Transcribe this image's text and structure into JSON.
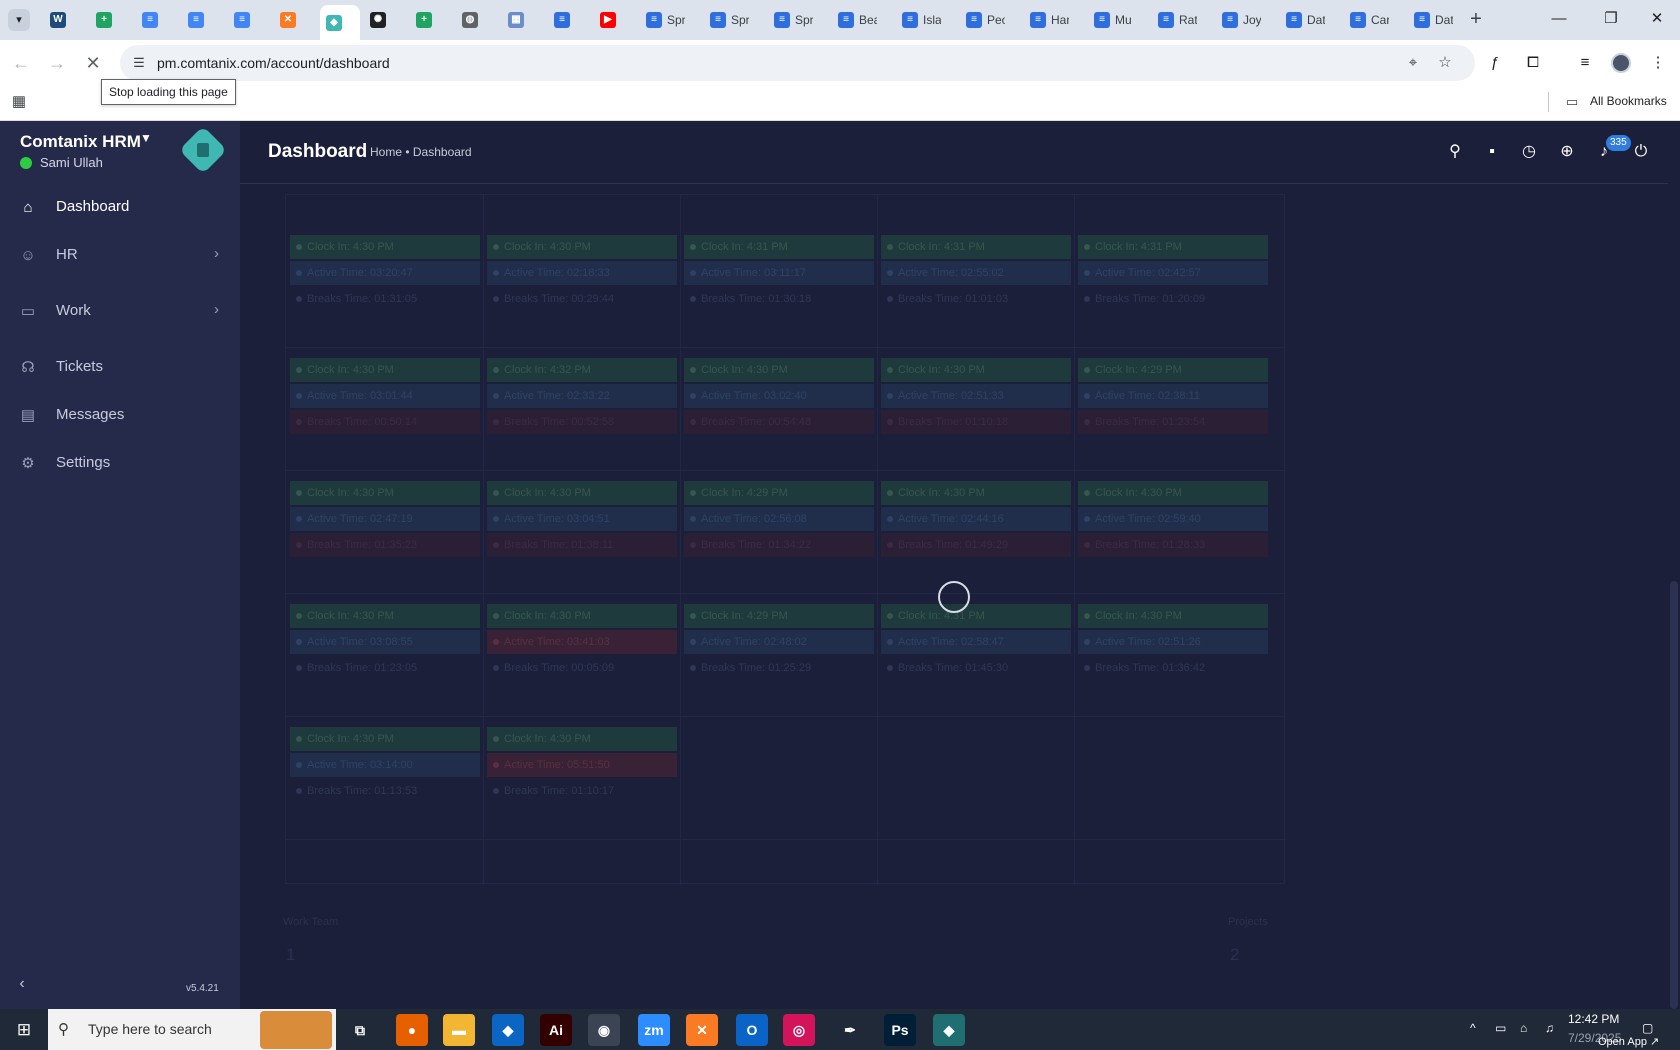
{
  "browser": {
    "tabs": [
      {
        "label": "",
        "icon": "wordpress-icon",
        "color": "#1e4b7a"
      },
      {
        "label": "",
        "icon": "google-sheets-icon",
        "color": "#1fa463"
      },
      {
        "label": "",
        "icon": "google-docs-icon",
        "color": "#4285f4"
      },
      {
        "label": "",
        "icon": "google-docs-icon",
        "color": "#4285f4"
      },
      {
        "label": "",
        "icon": "google-docs-icon",
        "color": "#4285f4"
      },
      {
        "label": "",
        "icon": "xampp-icon",
        "color": "#fb7a24"
      },
      {
        "label": "",
        "icon": "comtanix-icon",
        "color": "#3fb8b3",
        "active": true
      },
      {
        "label": "",
        "icon": "chatgpt-icon",
        "color": "#202124"
      },
      {
        "label": "",
        "icon": "google-sheets-icon",
        "color": "#1fa463"
      },
      {
        "label": "",
        "icon": "globe-icon",
        "color": "#5f6368"
      },
      {
        "label": "",
        "icon": "qr-icon",
        "color": "#6b8ec8"
      },
      {
        "label": "",
        "icon": "google-forms-icon",
        "color": "#2f6fdd"
      },
      {
        "label": "",
        "icon": "youtube-icon",
        "color": "#ff0000"
      },
      {
        "label": "Spr",
        "icon": "forms-icon",
        "color": "#2f6fdd"
      },
      {
        "label": "Spr",
        "icon": "forms-icon",
        "color": "#2f6fdd"
      },
      {
        "label": "Spr",
        "icon": "forms-icon",
        "color": "#2f6fdd"
      },
      {
        "label": "Bea",
        "icon": "forms-icon",
        "color": "#2f6fdd"
      },
      {
        "label": "Isla",
        "icon": "forms-icon",
        "color": "#2f6fdd"
      },
      {
        "label": "Peo",
        "icon": "forms-icon",
        "color": "#2f6fdd"
      },
      {
        "label": "Han",
        "icon": "forms-icon",
        "color": "#2f6fdd"
      },
      {
        "label": "Mu",
        "icon": "forms-icon",
        "color": "#2f6fdd"
      },
      {
        "label": "Rat",
        "icon": "forms-icon",
        "color": "#2f6fdd"
      },
      {
        "label": "Joy",
        "icon": "forms-icon",
        "color": "#2f6fdd"
      },
      {
        "label": "Dat",
        "icon": "forms-icon",
        "color": "#2f6fdd"
      },
      {
        "label": "Car",
        "icon": "forms-icon",
        "color": "#2f6fdd"
      },
      {
        "label": "Dat",
        "icon": "forms-icon",
        "color": "#2f6fdd"
      }
    ],
    "new_tab": "+",
    "url": "pm.comtanix.com/account/dashboard",
    "tooltip": "Stop loading this page",
    "all_bookmarks": "All Bookmarks"
  },
  "app": {
    "brand": "Comtanix HRM",
    "user": "Sami Ullah",
    "version": "v5.4.21",
    "menu": [
      {
        "label": "Dashboard",
        "icon": "home-icon",
        "active": true
      },
      {
        "label": "HR",
        "icon": "users-icon",
        "chevron": true
      },
      {
        "label": "Work",
        "icon": "briefcase-icon",
        "chevron": true
      },
      {
        "label": "Tickets",
        "icon": "headset-icon"
      },
      {
        "label": "Messages",
        "icon": "message-icon"
      },
      {
        "label": "Settings",
        "icon": "gear-icon"
      }
    ],
    "page_title": "Dashboard",
    "breadcrumb": "Home • Dashboard",
    "notification_count": "335",
    "footer_labels": [
      "Work Team",
      "Projects"
    ],
    "footer_values": [
      "1",
      "2"
    ]
  },
  "calendar": {
    "weeks": [
      [
        [
          "Clock In: 4:30 PM",
          "Active Time: 03:20:47",
          "Breaks Time: 01:31:05"
        ],
        [
          "Clock In: 4:30 PM",
          "Active Time: 02:18:33",
          "Breaks Time: 00:29:44"
        ],
        [
          "Clock In: 4:31 PM",
          "Active Time: 03:11:17",
          "Breaks Time: 01:30:18"
        ],
        [
          "Clock In: 4:31 PM",
          "Active Time: 02:55:02",
          "Breaks Time: 01:01:03"
        ],
        [
          "Clock In: 4:31 PM",
          "Active Time: 02:42:57",
          "Breaks Time: 01:20:09"
        ]
      ],
      [
        [
          "Clock In: 4:30 PM",
          "Active Time: 03:01:44",
          "Breaks Time: 00:50:14"
        ],
        [
          "Clock In: 4:32 PM",
          "Active Time: 02:33:22",
          "Breaks Time: 00:52:58"
        ],
        [
          "Clock In: 4:30 PM",
          "Active Time: 03:02:40",
          "Breaks Time: 00:54:48"
        ],
        [
          "Clock In: 4:30 PM",
          "Active Time: 02:51:33",
          "Breaks Time: 01:10:18"
        ],
        [
          "Clock In: 4:29 PM",
          "Active Time: 02:38:11",
          "Breaks Time: 01:23:54"
        ]
      ],
      [
        [
          "Clock In: 4:30 PM",
          "Active Time: 02:47:19",
          "Breaks Time: 01:35:23"
        ],
        [
          "Clock In: 4:30 PM",
          "Active Time: 03:04:51",
          "Breaks Time: 01:38:11"
        ],
        [
          "Clock In: 4:29 PM",
          "Active Time: 02:56:08",
          "Breaks Time: 01:34:22"
        ],
        [
          "Clock In: 4:30 PM",
          "Active Time: 02:44:16",
          "Breaks Time: 01:49:29"
        ],
        [
          "Clock In: 4:30 PM",
          "Active Time: 02:59:40",
          "Breaks Time: 01:28:33"
        ]
      ],
      [
        [
          "Clock In: 4:30 PM",
          "Active Time: 03:08:55",
          "Breaks Time: 01:23:05"
        ],
        [
          "Clock In: 4:30 PM",
          "Active Time: 03:41:03",
          "Breaks Time: 00:05:09"
        ],
        [
          "Clock In: 4:29 PM",
          "Active Time: 02:48:02",
          "Breaks Time: 01:25:29"
        ],
        [
          "Clock In: 4:31 PM",
          "Active Time: 02:58:47",
          "Breaks Time: 01:45:30"
        ],
        [
          "Clock In: 4:30 PM",
          "Active Time: 02:51:26",
          "Breaks Time: 01:36:42"
        ]
      ],
      [
        [
          "Clock In: 4:30 PM",
          "Active Time: 03:14:00",
          "Breaks Time: 01:13:53"
        ],
        [
          "Clock In: 4:30 PM",
          "Active Time: 05:51:50",
          "Breaks Time: 01:10:17"
        ]
      ]
    ]
  },
  "taskbar": {
    "search_placeholder": "Type here to search",
    "time": "12:42 PM",
    "date": "7/29/2025",
    "open_app": "Open App ↗",
    "apps": [
      {
        "name": "task-view-icon",
        "glyph": "⧉",
        "color": "transparent"
      },
      {
        "name": "firefox-icon",
        "glyph": "●",
        "color": "#e66000"
      },
      {
        "name": "file-explorer-icon",
        "glyph": "▬",
        "color": "#f2b632"
      },
      {
        "name": "vscode-icon",
        "glyph": "◆",
        "color": "#0a66c2"
      },
      {
        "name": "illustrator-icon",
        "glyph": "Ai",
        "color": "#330000"
      },
      {
        "name": "chrome-icon",
        "glyph": "◉",
        "color": "#3a4453"
      },
      {
        "name": "zoom-icon",
        "glyph": "zm",
        "color": "#2d8cff"
      },
      {
        "name": "xampp-icon",
        "glyph": "✕",
        "color": "#fb7a24"
      },
      {
        "name": "outlook-icon",
        "glyph": "O",
        "color": "#0a64c8"
      },
      {
        "name": "creative-cloud-icon",
        "glyph": "◎",
        "color": "#d4145a"
      },
      {
        "name": "pen-tool-icon",
        "glyph": "✒",
        "color": "transparent"
      },
      {
        "name": "photoshop-icon",
        "glyph": "Ps",
        "color": "#001e36"
      },
      {
        "name": "comtanix-icon",
        "glyph": "◆",
        "color": "#1f6f72"
      }
    ]
  }
}
